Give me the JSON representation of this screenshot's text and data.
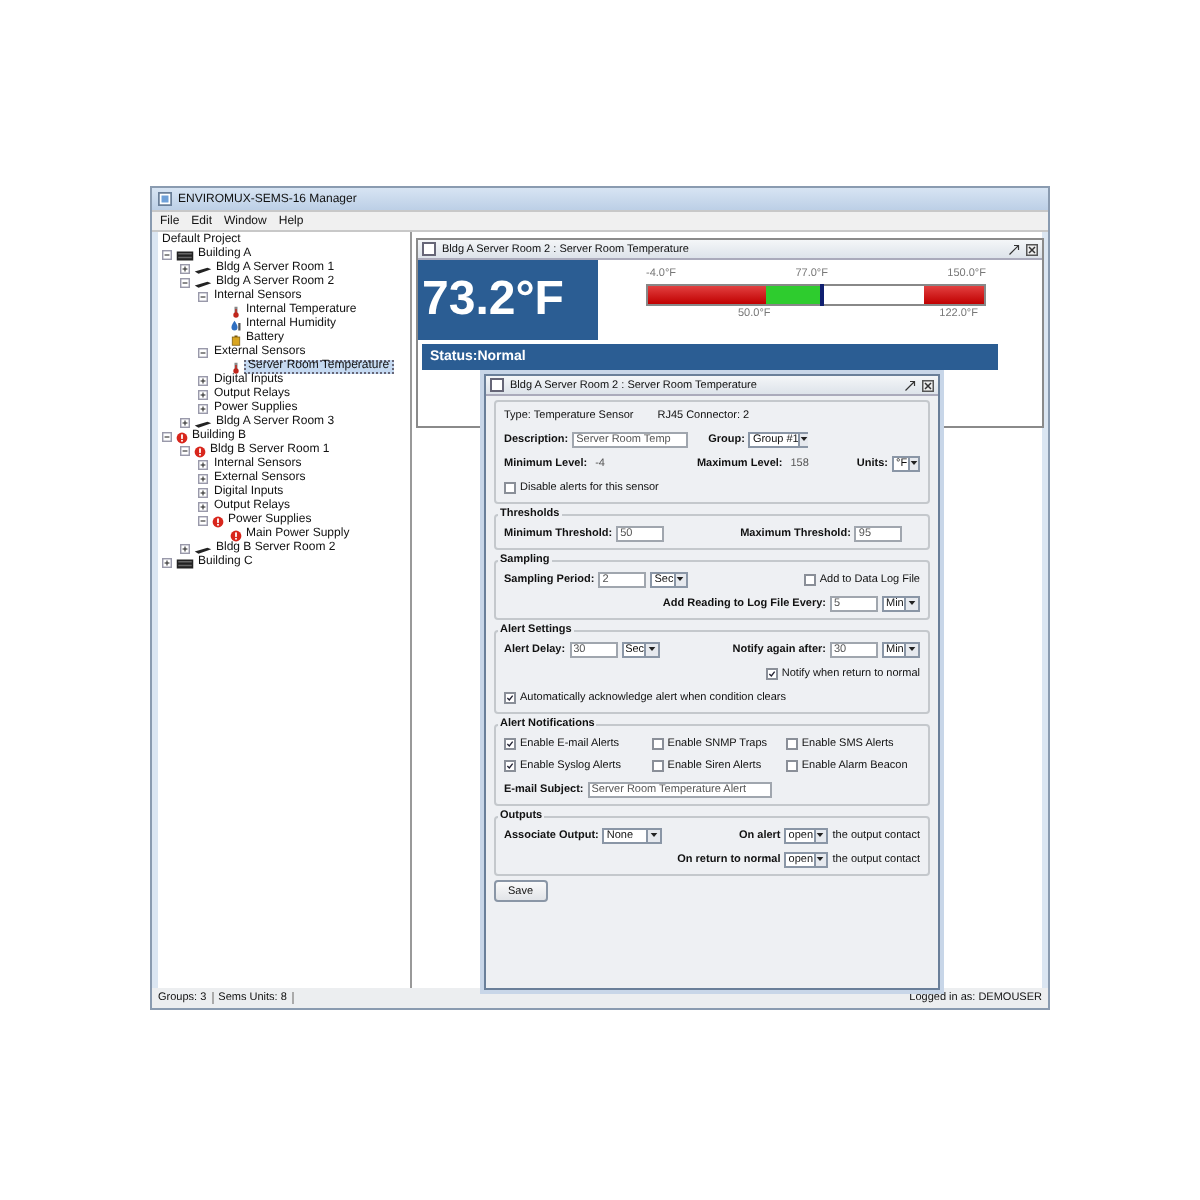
{
  "window": {
    "title": "ENVIROMUX-SEMS-16 Manager"
  },
  "menu": [
    "File",
    "Edit",
    "Window",
    "Help"
  ],
  "tree": {
    "root": "Default Project",
    "items": [
      {
        "label": "Building A",
        "kind": "building",
        "expanded": true,
        "selected": false,
        "children": [
          {
            "label": "Bldg A Server Room 1",
            "kind": "room",
            "expanded": false,
            "selected": false
          },
          {
            "label": "Bldg A Server Room 2",
            "kind": "room",
            "expanded": true,
            "selected": false,
            "children": [
              {
                "label": "Internal Sensors",
                "kind": "group",
                "expanded": true,
                "selected": false,
                "children": [
                  {
                    "label": "Internal Temperature",
                    "kind": "temperature",
                    "selected": false
                  },
                  {
                    "label": "Internal Humidity",
                    "kind": "humidity",
                    "selected": false
                  },
                  {
                    "label": "Battery",
                    "kind": "battery",
                    "selected": false
                  }
                ]
              },
              {
                "label": "External Sensors",
                "kind": "group",
                "expanded": true,
                "selected": false,
                "children": [
                  {
                    "label": "Server Room Temperature",
                    "kind": "temperature",
                    "selected": true
                  }
                ]
              },
              {
                "label": "Digital Inputs",
                "kind": "group",
                "expanded": false,
                "selected": false
              },
              {
                "label": "Output Relays",
                "kind": "group",
                "expanded": false,
                "selected": false
              },
              {
                "label": "Power Supplies",
                "kind": "group",
                "expanded": false,
                "selected": false
              }
            ]
          },
          {
            "label": "Bldg A Server Room 3",
            "kind": "room",
            "expanded": false,
            "selected": false
          }
        ]
      },
      {
        "label": "Building B",
        "kind": "alarm",
        "expanded": true,
        "selected": false,
        "children": [
          {
            "label": "Bldg B Server Room 1",
            "kind": "alarm",
            "expanded": true,
            "selected": false,
            "children": [
              {
                "label": "Internal Sensors",
                "kind": "group",
                "expanded": false,
                "selected": false
              },
              {
                "label": "External Sensors",
                "kind": "group",
                "expanded": false,
                "selected": false
              },
              {
                "label": "Digital Inputs",
                "kind": "group",
                "expanded": false,
                "selected": false
              },
              {
                "label": "Output Relays",
                "kind": "group",
                "expanded": false,
                "selected": false
              },
              {
                "label": "Power Supplies",
                "kind": "alarm",
                "expanded": true,
                "selected": false,
                "children": [
                  {
                    "label": "Main Power Supply",
                    "kind": "alarm",
                    "selected": false
                  }
                ]
              }
            ]
          },
          {
            "label": "Bldg B Server Room 2",
            "kind": "room",
            "expanded": false,
            "selected": false
          }
        ]
      },
      {
        "label": "Building C",
        "kind": "building",
        "expanded": false,
        "selected": false
      }
    ]
  },
  "monitor_window": {
    "title": "Bldg A Server Room 2 : Server Room Temperature",
    "reading": "73.2°F",
    "level": 0.52,
    "scale_top": [
      "-4.0°F",
      "77.0°F",
      "150.0°F"
    ],
    "scale_bottom": [
      "50.0°F",
      "122.0°F"
    ],
    "status": "Status:Normal"
  },
  "dialog": {
    "title": "Bldg A Server Room 2 : Server Room Temperature",
    "general": {
      "type": "Type: Temperature Sensor",
      "connector": "RJ45 Connector: 2",
      "description": {
        "label": "Description:",
        "value": "Server Room Temp"
      },
      "group": {
        "label": "Group:",
        "value": "Group #1"
      },
      "min_level": {
        "label": "Minimum Level:",
        "value": "-4"
      },
      "max_level": {
        "label": "Maximum Level:",
        "value": "158"
      },
      "units": {
        "label": "Units:",
        "value": "°F"
      },
      "disable_alerts": {
        "label": "Disable alerts for this sensor",
        "checked": false
      }
    },
    "thresholds": {
      "title": "Thresholds",
      "minimum": {
        "label": "Minimum Threshold:",
        "value": "50"
      },
      "maximum": {
        "label": "Maximum Threshold:",
        "value": "95"
      }
    },
    "sampling": {
      "title": "Sampling",
      "period": {
        "label": "Sampling Period:",
        "value": "2",
        "unit": "Sec"
      },
      "data_log": {
        "label": "Add to Data Log File",
        "checked": false
      },
      "log_every": {
        "label": "Add Reading to Log File Every:",
        "value": "5",
        "unit": "Min"
      }
    },
    "alert_settings": {
      "title": "Alert Settings",
      "delay": {
        "label": "Alert Delay:",
        "value": "30",
        "unit": "Sec"
      },
      "notify_again": {
        "label": "Notify again after:",
        "value": "30",
        "unit": "Min"
      },
      "notify_return": {
        "label": "Notify when return to normal",
        "checked": true
      },
      "auto_ack": {
        "label": "Automatically acknowledge alert when condition clears",
        "checked": true
      }
    },
    "notifications": {
      "title": "Alert Notifications",
      "options": [
        {
          "label": "Enable E-mail Alerts",
          "checked": true
        },
        {
          "label": "Enable SNMP Traps",
          "checked": false
        },
        {
          "label": "Enable SMS Alerts",
          "checked": false
        },
        {
          "label": "Enable Syslog Alerts",
          "checked": true
        },
        {
          "label": "Enable Siren Alerts",
          "checked": false
        },
        {
          "label": "Enable Alarm Beacon",
          "checked": false
        }
      ],
      "subject": {
        "label": "E-mail Subject:",
        "value": "Server Room Temperature Alert"
      }
    },
    "outputs": {
      "title": "Outputs",
      "associate": {
        "label": "Associate Output:",
        "value": "None"
      },
      "on_alert": {
        "label": "On alert",
        "value": "open",
        "suffix": "the output contact"
      },
      "on_return": {
        "label": "On return to normal",
        "value": "open",
        "suffix": "the output contact"
      }
    },
    "save": "Save"
  },
  "status_bar": {
    "groups": "Groups: 3",
    "units": "Sems Units: 8",
    "user": "Logged in as: DEMOUSER"
  }
}
